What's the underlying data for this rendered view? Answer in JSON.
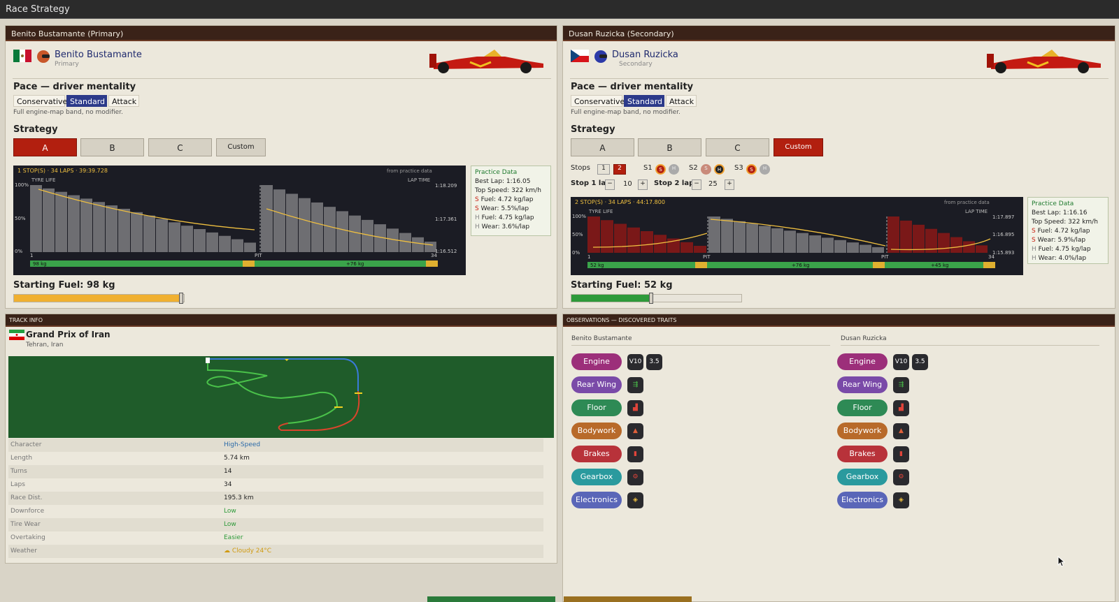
{
  "window_title": "Race Strategy",
  "drivers": [
    {
      "panel_title": "Benito Bustamante (Primary)",
      "name": "Benito Bustamante",
      "role": "Primary",
      "flag": "mexico-flag",
      "pace_title": "Pace — driver mentality",
      "mentality": [
        "Conservative",
        "Standard",
        "Attack"
      ],
      "mentality_selected": "Standard",
      "mentality_hint": "Full engine-map band, no modifier.",
      "strategy_title": "Strategy",
      "strategies": [
        "A",
        "B",
        "C",
        "Custom"
      ],
      "strategy_selected": "A",
      "chart": {
        "header": "1 STOP(S) · 34 LAPS · 39:39.728",
        "source": "from practice data",
        "tyre_life": "TYRE LIFE",
        "lap_time": "LAP TIME",
        "y_ticks": [
          "100%",
          "50%",
          "0%"
        ],
        "lap_ticks": [
          "1:18.209",
          "1:17.361",
          "1:16.512"
        ],
        "x_labels": [
          "1",
          "PIT",
          "34"
        ],
        "fuel_labels": [
          "98 kg",
          "+76 kg"
        ]
      },
      "practice": {
        "title": "Practice Data",
        "best_lap": "Best Lap: 1:16.05",
        "top_speed": "Top Speed: 322 km/h",
        "rows": [
          {
            "k": "S",
            "t": "Fuel: 4.72 kg/lap"
          },
          {
            "k": "S",
            "t": "Wear: 5.5%/lap"
          },
          {
            "k": "H",
            "t": "Fuel: 4.75 kg/lap"
          },
          {
            "k": "H",
            "t": "Wear: 3.6%/lap"
          }
        ]
      },
      "starting_fuel": "Starting Fuel: 98 kg",
      "fuel_fraction": 0.98
    },
    {
      "panel_title": "Dusan Ruzicka (Secondary)",
      "name": "Dusan Ruzicka",
      "role": "Secondary",
      "flag": "czech-flag",
      "pace_title": "Pace — driver mentality",
      "mentality": [
        "Conservative",
        "Standard",
        "Attack"
      ],
      "mentality_selected": "Standard",
      "mentality_hint": "Full engine-map band, no modifier.",
      "strategy_title": "Strategy",
      "strategies": [
        "A",
        "B",
        "C",
        "Custom"
      ],
      "strategy_selected": "Custom",
      "stops_label": "Stops",
      "stops_options": [
        "1",
        "2"
      ],
      "stops_selected": "2",
      "stint_labels": [
        "S1",
        "S2",
        "S3"
      ],
      "stint_tyres": [
        "S",
        "H",
        "S"
      ],
      "stop1_label": "Stop 1 lap",
      "stop1_value": "10",
      "stop2_label": "Stop 2 lap",
      "stop2_value": "25",
      "chart": {
        "header": "2 STOP(S) · 34 LAPS · 44:17.800",
        "source": "from practice data",
        "tyre_life": "TYRE LIFE",
        "lap_time": "LAP TIME",
        "y_ticks": [
          "100%",
          "50%",
          "0%"
        ],
        "lap_ticks": [
          "1:17.897",
          "1:16.895",
          "1:15.893"
        ],
        "x_labels": [
          "1",
          "PIT",
          "PIT",
          "34"
        ],
        "fuel_labels": [
          "52 kg",
          "+76 kg",
          "+45 kg"
        ]
      },
      "practice": {
        "title": "Practice Data",
        "best_lap": "Best Lap: 1:16.16",
        "top_speed": "Top Speed: 322 km/h",
        "rows": [
          {
            "k": "S",
            "t": "Fuel: 4.72 kg/lap"
          },
          {
            "k": "S",
            "t": "Wear: 5.9%/lap"
          },
          {
            "k": "H",
            "t": "Fuel: 4.75 kg/lap"
          },
          {
            "k": "H",
            "t": "Wear: 4.0%/lap"
          }
        ]
      },
      "starting_fuel": "Starting Fuel: 52 kg",
      "fuel_fraction": 0.47
    }
  ],
  "track": {
    "panel_title": "TRACK INFO",
    "name": "Grand Prix of Iran",
    "location": "Tehran, Iran",
    "rows": [
      {
        "k": "Character",
        "v": "High-Speed"
      },
      {
        "k": "Length",
        "v": "5.74 km"
      },
      {
        "k": "Turns",
        "v": "14"
      },
      {
        "k": "Laps",
        "v": "34"
      },
      {
        "k": "Race Dist.",
        "v": "195.3 km"
      },
      {
        "k": "Downforce",
        "v": "Low"
      },
      {
        "k": "Tire Wear",
        "v": "Low"
      },
      {
        "k": "Overtaking",
        "v": "Easier"
      },
      {
        "k": "Weather",
        "v": "☁ Cloudy 24°C"
      }
    ]
  },
  "observations": {
    "panel_title": "OBSERVATIONS — DISCOVERED TRAITS",
    "driver_names": [
      "Benito Bustamante",
      "Dusan Ruzicka"
    ],
    "traits": [
      "Engine",
      "Rear Wing",
      "Floor",
      "Bodywork",
      "Brakes",
      "Gearbox",
      "Electronics"
    ],
    "engine_chips": [
      "V10",
      "3.5"
    ],
    "trait_colors": [
      "#9c2f7a",
      "#7a4aa8",
      "#2e8a55",
      "#b86a2a",
      "#b8323a",
      "#2a9a9e",
      "#5a66b8"
    ]
  }
}
